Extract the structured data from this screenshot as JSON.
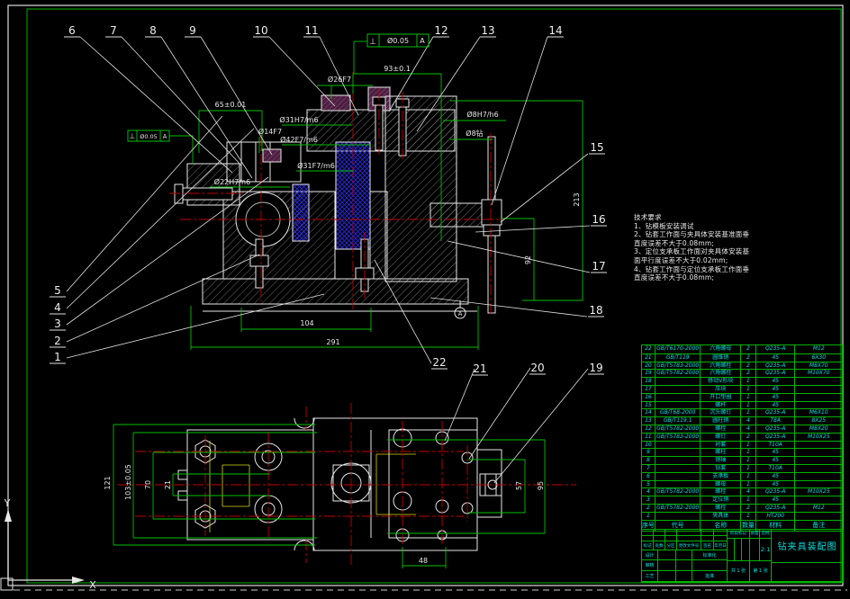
{
  "colors": {
    "background": "#000000",
    "outline_white": "#e8e8e8",
    "dimension_green": "#00c000",
    "table_cyan": "#00e0e0",
    "centerline_red": "#c00000",
    "hatch_blue": "#2a2ae0",
    "hidden_yellow": "#d8d800",
    "bushing_purple": "#6b2d56"
  },
  "ucs": {
    "x_label": "X",
    "y_label": "Y"
  },
  "tech_notes": {
    "title": "技术要求",
    "lines": [
      "1、钻模板安装调试",
      "2、钻套工作面与夹具体安装基准面垂",
      "直度误差不大于0.08mm;",
      "3、定位支承板工作面对夹具体安装基",
      "面平行度误差不大于0.02mm;",
      "4、钻套工作面与定位支承板工作面垂",
      "直度误差不大于0.08mm;"
    ]
  },
  "gdt": {
    "symbol": "⊥",
    "tolerance": "Ø0.05",
    "datum": "A"
  },
  "datum": {
    "label": "A"
  },
  "balloons": {
    "b1": "1",
    "b2": "2",
    "b3": "3",
    "b4": "4",
    "b5": "5",
    "b6": "6",
    "b7": "7",
    "b8": "8",
    "b9": "9",
    "b10": "10",
    "b11": "11",
    "b12": "12",
    "b13": "13",
    "b14": "14",
    "b15": "15",
    "b16": "16",
    "b17": "17",
    "b18": "18",
    "b19": "19",
    "b20": "20",
    "b21": "21",
    "b22": "22"
  },
  "dims": {
    "d65": "65±0.01",
    "d93": "93±0.1",
    "d26": "Ø26F7",
    "d14": "Ø14F7",
    "d31h": "Ø31H7/m6",
    "d42": "Ø42F7/m6",
    "d31f": "Ø31F7/m6",
    "d22": "Ø22H7/n6",
    "d8h": "Ø8H7/h6",
    "d8z": "Ø8钻",
    "d104": "104",
    "d291": "291",
    "d213": "213",
    "d92": "92",
    "d121": "121",
    "d103": "103±0.05",
    "d70": "70",
    "d21": "21",
    "d57": "57",
    "d95": "95",
    "d48": "48"
  },
  "parts_table": {
    "headers": [
      "序号",
      "代号",
      "名称",
      "数量",
      "材料",
      "备注"
    ],
    "rows": [
      [
        "22",
        "GB/T6170-2000",
        "六角螺母",
        "2",
        "Q235-A",
        "M12"
      ],
      [
        "21",
        "GB/T119",
        "圆锥销",
        "2",
        "45",
        "6X30"
      ],
      [
        "20",
        "GB/T5783-2000",
        "六角螺栓",
        "2",
        "Q235-A",
        "M8X70"
      ],
      [
        "19",
        "GB/T5782-2000",
        "六角螺栓",
        "2",
        "Q235-A",
        "M10X70"
      ],
      [
        "18",
        "",
        "移动V形块",
        "1",
        "45",
        ""
      ],
      [
        "17",
        "",
        "压块",
        "1",
        "45",
        ""
      ],
      [
        "16",
        "",
        "开口垫圈",
        "1",
        "45",
        ""
      ],
      [
        "15",
        "",
        "螺杆",
        "1",
        "45",
        ""
      ],
      [
        "14",
        "GB/T68-2000",
        "沉头螺钉",
        "1",
        "Q235-A",
        "M6X10"
      ],
      [
        "13",
        "GB/T119.1",
        "圆柱销",
        "4",
        "T8A",
        "8X25"
      ],
      [
        "12",
        "GB/T5782-2000",
        "螺栓",
        "4",
        "Q235-A",
        "M8X20"
      ],
      [
        "11",
        "GB/T5783-2000",
        "螺钉",
        "2",
        "Q235-A",
        "M10X25"
      ],
      [
        "10",
        "",
        "衬套",
        "1",
        "T10A",
        ""
      ],
      [
        "9",
        "",
        "螺柱",
        "1",
        "45",
        ""
      ],
      [
        "8",
        "",
        "销轴",
        "1",
        "45",
        ""
      ],
      [
        "7",
        "",
        "钻套",
        "1",
        "T10A",
        ""
      ],
      [
        "6",
        "",
        "支承板",
        "1",
        "45",
        ""
      ],
      [
        "5",
        "",
        "螺母",
        "1",
        "45",
        ""
      ],
      [
        "4",
        "GB/T5782-2000",
        "螺栓",
        "4",
        "Q235-A",
        "M10X25"
      ],
      [
        "3",
        "",
        "定位销",
        "1",
        "45",
        ""
      ],
      [
        "2",
        "GB/T5782-2000",
        "螺栓",
        "2",
        "Q235-A",
        "M12"
      ],
      [
        "1",
        "",
        "夹具体",
        "1",
        "HT200",
        ""
      ]
    ]
  },
  "title_block": {
    "title": "钻夹具装配图",
    "row_labels": [
      "标记",
      "处数",
      "分区",
      "更改文件号",
      "签名",
      "年月日"
    ],
    "design": "设计",
    "check": "审核",
    "process": "工艺",
    "standard": "标准化",
    "approve": "批准",
    "stage": "阶段标记",
    "mass": "质量",
    "scale": "比例",
    "scale_value": "2:1",
    "sheet_total": "共 1 张",
    "sheet_no": "第 1 张"
  }
}
